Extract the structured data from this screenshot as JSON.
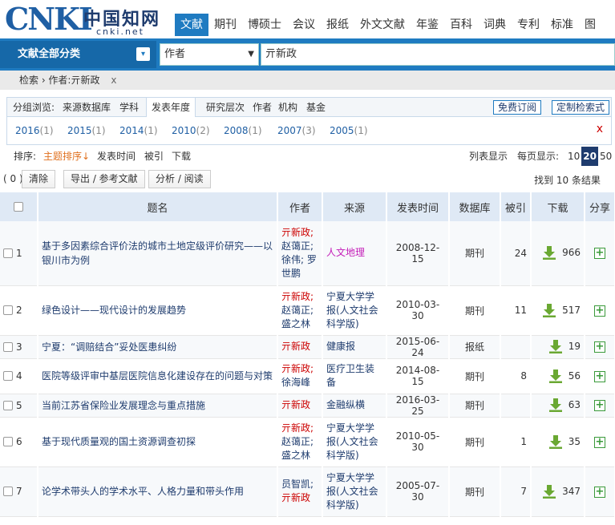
{
  "logo": {
    "text": "CNKI",
    "cn": "中国知网",
    "domain": "cnki.net"
  },
  "nav": [
    "文献",
    "期刊",
    "博硕士",
    "会议",
    "报纸",
    "外文文献",
    "年鉴",
    "百科",
    "词典",
    "专利",
    "标准",
    "图"
  ],
  "search": {
    "category": "文献全部分类",
    "field": "作者",
    "value": "亓新政"
  },
  "breadcrumb": {
    "text": "检索 › 作者:亓新政",
    "close": "x"
  },
  "group": {
    "label": "分组浏览:",
    "tabs": [
      "来源数据库",
      "学科",
      "发表年度",
      "研究层次",
      "作者",
      "机构",
      "基金"
    ],
    "buttons": [
      "免费订阅",
      "定制检索式"
    ],
    "years": [
      {
        "year": "2016",
        "count": "(1)"
      },
      {
        "year": "2015",
        "count": "(1)"
      },
      {
        "year": "2014",
        "count": "(1)"
      },
      {
        "year": "2010",
        "count": "(2)"
      },
      {
        "year": "2008",
        "count": "(1)"
      },
      {
        "year": "2007",
        "count": "(3)"
      },
      {
        "year": "2005",
        "count": "(1)"
      }
    ],
    "close": "x"
  },
  "sort": {
    "label": "排序:",
    "options": [
      "主题排序↓",
      "发表时间",
      "被引",
      "下载"
    ],
    "list_view": "列表显示",
    "per_page_label": "每页显示:",
    "per_page": [
      "10",
      "20",
      "50"
    ]
  },
  "tools": {
    "count": "( 0 )",
    "clear": "清除",
    "export": "导出 / 参考文献",
    "analyze": "分析 / 阅读",
    "found": "找到 10 条结果"
  },
  "table": {
    "headers": [
      "题名",
      "作者",
      "来源",
      "发表时间",
      "数据库",
      "被引",
      "下载",
      "分享"
    ],
    "rows": [
      {
        "num": "1",
        "title": "基于多因素综合评价法的城市土地定级评价研究——以银川市为例",
        "authors_red": "亓新政;",
        "authors_black": "赵蔼正;\n徐伟; 罗\n世鹏",
        "source": "人文地理",
        "date": "2008-12-15",
        "db": "期刊",
        "cited": "24",
        "downloads": "966"
      },
      {
        "num": "2",
        "title": "绿色设计——现代设计的发展趋势",
        "authors_red": "亓新政;",
        "authors_black": "赵蔼正;\n盛之林",
        "source": "宁夏大学学\n报(人文社会\n科学版)",
        "date": "2010-03-30",
        "db": "期刊",
        "cited": "11",
        "downloads": "517"
      },
      {
        "num": "3",
        "title": "宁夏：“调赔结合”妥处医患纠纷",
        "authors_red": "亓新政",
        "authors_black": "",
        "source": "健康报",
        "date": "2015-06-24",
        "db": "报纸",
        "cited": "",
        "downloads": "19"
      },
      {
        "num": "4",
        "title": "医院等级评审中基层医院信息化建设存在的问题与对策",
        "authors_red": "亓新政;",
        "authors_black": "徐海峰",
        "source": "医疗卫生装\n备",
        "date": "2014-08-15",
        "db": "期刊",
        "cited": "8",
        "downloads": "56"
      },
      {
        "num": "5",
        "title": "当前江苏省保险业发展理念与重点措施",
        "authors_red": "亓新政",
        "authors_black": "",
        "source": "金融纵横",
        "date": "2016-03-25",
        "db": "期刊",
        "cited": "",
        "downloads": "63"
      },
      {
        "num": "6",
        "title": "基于现代质量观的国土资源调查初探",
        "authors_red": "亓新政;",
        "authors_black": "赵蔼正;\n盛之林",
        "source": "宁夏大学学\n报(人文社会\n科学版)",
        "date": "2010-05-30",
        "db": "期刊",
        "cited": "1",
        "downloads": "35"
      },
      {
        "num": "7",
        "title": "论学术带头人的学术水平、人格力量和带头作用",
        "authors_red": "亓新政",
        "authors_black": "员智凯;",
        "authors_order": "black_first",
        "source": "宁夏大学学\n报(人文社会\n科学版)",
        "date": "2005-07-30",
        "db": "期刊",
        "cited": "7",
        "downloads": "347"
      }
    ]
  },
  "colors": {
    "brand": "#1f7bc1",
    "header_bg": "#dfe9f5",
    "author_highlight": "#cc0000",
    "link": "#1f3c6e"
  }
}
